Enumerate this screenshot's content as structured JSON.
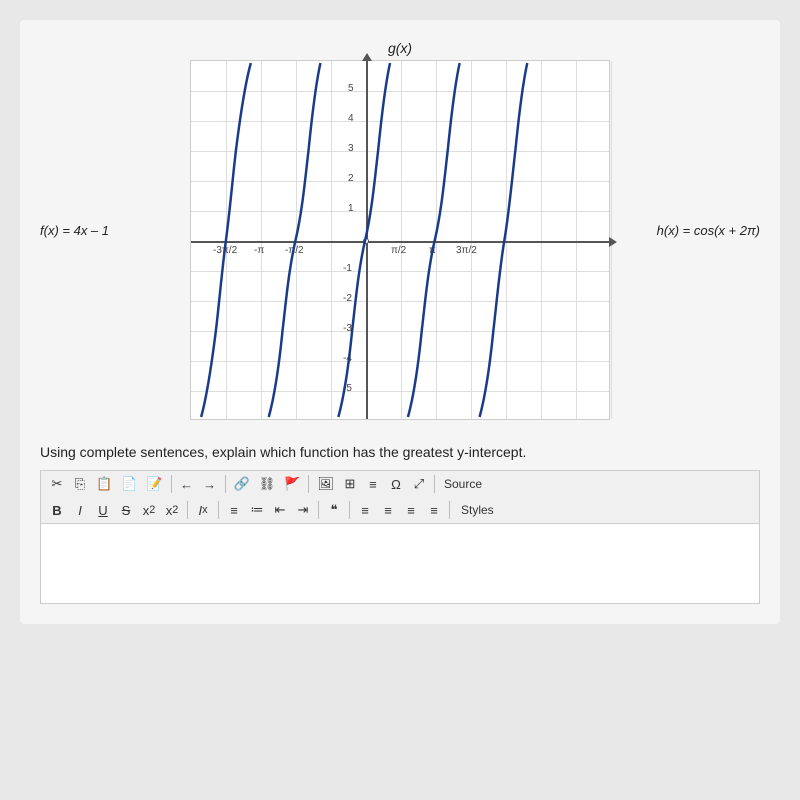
{
  "graph": {
    "title": "g(x)",
    "label_left": "f(x) = 4x – 1",
    "label_right": "h(x) = cos(x + 2π)",
    "x_axis_labels": [
      "-3π/2",
      "-π",
      "-π/2",
      "π/2",
      "π",
      "3π/2"
    ],
    "y_axis_labels": [
      "5",
      "4",
      "3",
      "2",
      "1",
      "-1",
      "-2",
      "-3",
      "-4",
      "-5"
    ]
  },
  "question": {
    "text": "Using complete sentences, explain which function has the greatest y-intercept."
  },
  "toolbar_row1": {
    "btns": [
      "✂",
      "📋",
      "📋",
      "📋",
      "📋",
      "←",
      "→",
      "🔗",
      "🔗",
      "🚩",
      "🖼",
      "⊞",
      "≡",
      "Ω",
      "⤢",
      "Source"
    ]
  },
  "toolbar_row2": {
    "bold": "B",
    "italic": "I",
    "underline": "U",
    "strikethrough": "S",
    "subscript": "x₂",
    "superscript": "x²",
    "clear_format": "Iₓ",
    "ol": "≡",
    "ul": "≔",
    "indent_less": "⇤",
    "indent_more": "⇥",
    "blockquote": "❝",
    "align_left": "≡",
    "align_center": "≡",
    "align_right": "≡",
    "align_justify": "≡",
    "styles": "Styles"
  }
}
